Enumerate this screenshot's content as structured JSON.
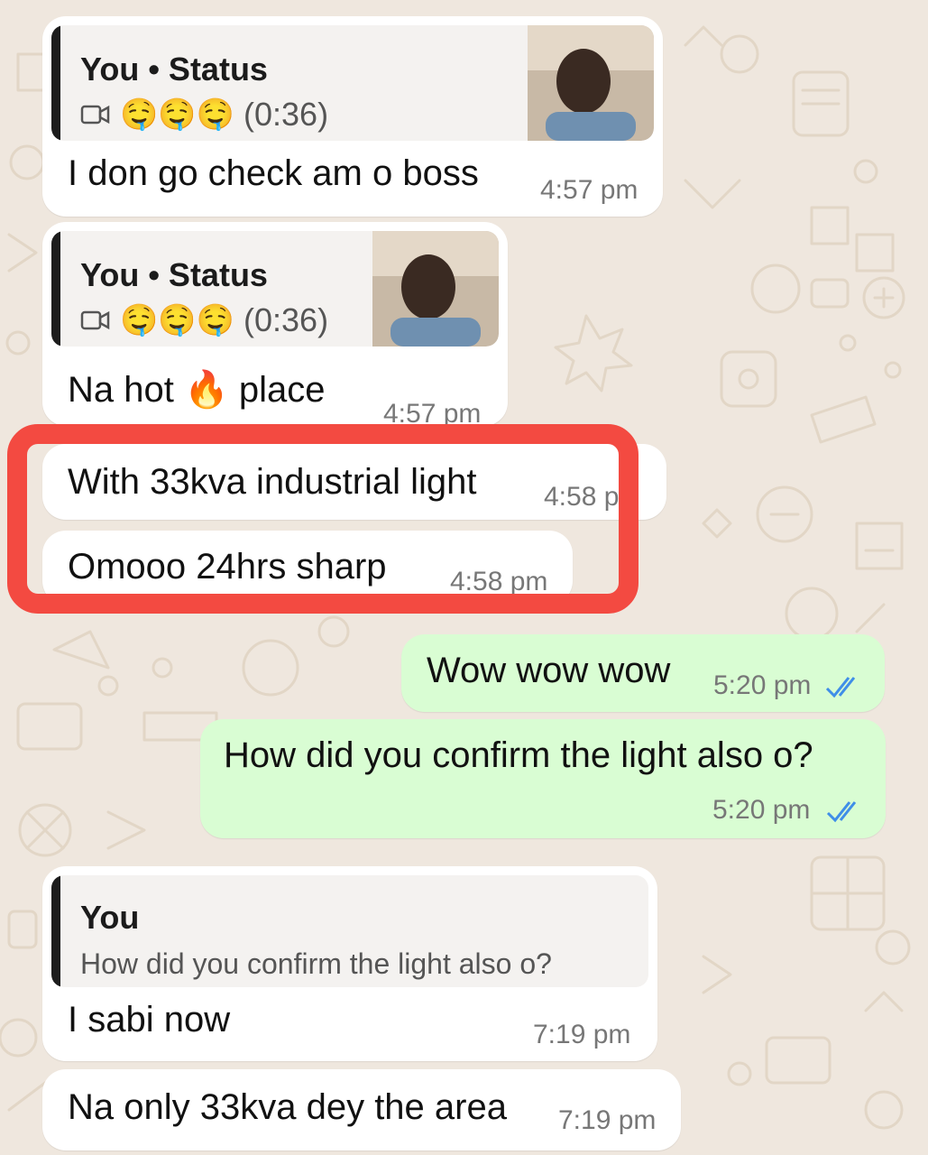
{
  "messages": [
    {
      "quote_title": "You • Status",
      "quote_emoji": "🤤🤤🤤",
      "quote_duration": "(0:36)",
      "text": "I don go check am o boss",
      "time": "4:57 pm"
    },
    {
      "quote_title": "You • Status",
      "quote_emoji": "🤤🤤🤤",
      "quote_duration": "(0:36)",
      "text_a": "Na hot",
      "text_emoji": "🔥",
      "text_b": "place",
      "time": "4:57 pm"
    },
    {
      "text": "With 33kva industrial light",
      "time": "4:58 p"
    },
    {
      "text": "Omooo  24hrs sharp",
      "time": "4:58 pm"
    },
    {
      "text": "Wow wow wow",
      "time": "5:20 pm"
    },
    {
      "text": "How did you confirm the light also o?",
      "time": "5:20 pm"
    },
    {
      "quote_title": "You",
      "quote_text": "How did you confirm the light also o?",
      "text": "I sabi now",
      "time": "7:19 pm"
    },
    {
      "text": "Na only 33kva dey the area",
      "time": "7:19 pm"
    }
  ],
  "colors": {
    "background": "#efe7de",
    "incoming": "#ffffff",
    "outgoing": "#d9fdd3",
    "read_ticks": "#3f8ee8",
    "highlight": "#f34a41"
  }
}
